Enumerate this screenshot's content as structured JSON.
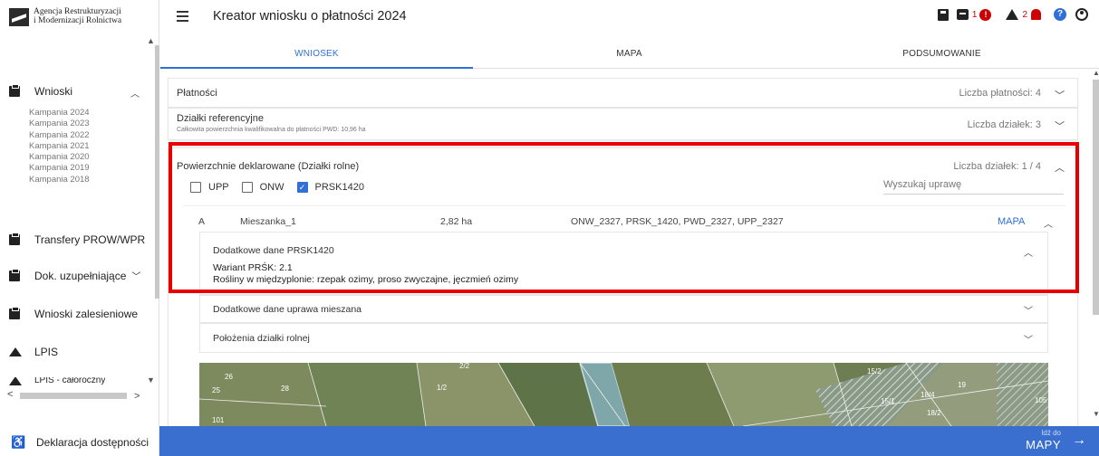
{
  "sidebar": {
    "logo_line1": "Agencja Restrukturyzacji",
    "logo_line2": "i Modernizacji Rolnictwa",
    "wnioski": "Wnioski",
    "campaigns": [
      "Kampania 2024",
      "Kampania 2023",
      "Kampania 2022",
      "Kampania 2021",
      "Kampania 2020",
      "Kampania 2019",
      "Kampania 2018"
    ],
    "transfery": "Transfery PROW/WPR",
    "dok": "Dok. uzupełniające",
    "zalesieniowe": "Wnioski zalesieniowe",
    "lpis": "LPIS",
    "lpis_cut": "LPIS - całoroczny",
    "deklaracja": "Deklaracja dostępności"
  },
  "header": {
    "title": "Kreator wniosku o płatności 2024",
    "error_count": "1",
    "warning_count": "2"
  },
  "tabs": [
    "WNIOSEK",
    "MAPA",
    "PODSUMOWANIE"
  ],
  "platnosci": {
    "title": "Płatności",
    "right": "Liczba płatności: 4"
  },
  "dzialki_ref": {
    "title": "Działki referencyjne",
    "subtitle": "Całkowita powierzchnia kwalifikowalna do płatności PWD: 10,96 ha",
    "right": "Liczba działek: 3"
  },
  "powierzchnie": {
    "title": "Powierzchnie deklarowane (Działki rolne)",
    "right": "Liczba działek: 1 / 4",
    "checkboxes": [
      {
        "label": "UPP",
        "checked": false
      },
      {
        "label": "ONW",
        "checked": false
      },
      {
        "label": "PRSK1420",
        "checked": true
      }
    ],
    "search_placeholder": "Wyszukaj uprawę",
    "row": {
      "letter": "A",
      "name": "Mieszanka_1",
      "area": "2,82 ha",
      "codes": "ONW_2327, PRSK_1420, PWD_2327, UPP_2327",
      "map_link": "MAPA"
    },
    "prsk": {
      "title": "Dodatkowe dane PRSK1420",
      "wariant": "Wariant PRŚK: 2.1",
      "rosliny": "Rośliny w międzyplonie: rzepak ozimy, proso zwyczajne, jęczmień ozimy"
    },
    "uprawa_mieszana": "Dodatkowe dane uprawa mieszana",
    "polozenia": "Położenia działki rolnej"
  },
  "map_labels": [
    "26",
    "25",
    "28",
    "1/2",
    "2/2",
    "15/2",
    "19",
    "15/1",
    "18/4",
    "18/2",
    "101",
    "105"
  ],
  "bottom": {
    "small": "Idź do",
    "big": "MAPY"
  },
  "colors": {
    "accent": "#2f6fd6",
    "highlight": "#e80000",
    "bottom_bar": "#3a6fd0"
  }
}
